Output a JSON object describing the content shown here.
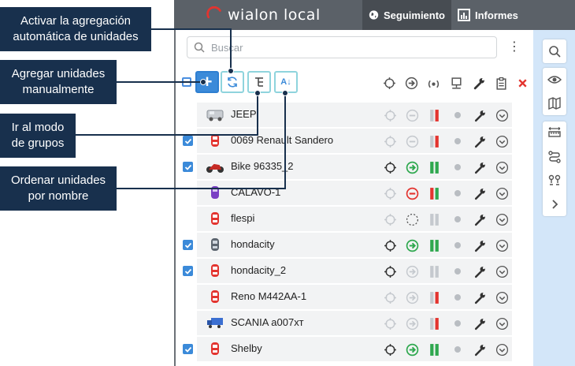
{
  "header": {
    "logo_text": "wialon local",
    "tabs": [
      {
        "label": "Seguimiento",
        "icon": "globe-icon",
        "active": true
      },
      {
        "label": "Informes",
        "icon": "chart-icon",
        "active": false
      }
    ],
    "colors": {
      "bar": "#5b6168",
      "active_tab": "#474c52",
      "logo_accent": "#e3342f"
    }
  },
  "search": {
    "placeholder": "Buscar",
    "value": ""
  },
  "toolbar": {
    "add_label": "+",
    "sort_label": "A↓",
    "right_icons": [
      "locator-icon",
      "arrow-right-circle-icon",
      "signal-icon",
      "monitor-icon",
      "wrench-icon",
      "clipboard-icon",
      "close-icon"
    ]
  },
  "callouts": [
    {
      "text": "Activar la agregación automática de unidades"
    },
    {
      "text": "Agregar unidades manualmente"
    },
    {
      "text": "Ir al modo de grupos"
    },
    {
      "text": "Ordenar unidades por nombre"
    }
  ],
  "units": [
    {
      "name": "JEEP",
      "checked": false,
      "icon": "jeep-icon",
      "loc": "grey",
      "move": "grey-minus",
      "sig": "grey-red",
      "active": false
    },
    {
      "name": "0069 Renault Sandero",
      "checked": true,
      "icon": "red-car-icon",
      "loc": "grey",
      "move": "grey-minus",
      "sig": "grey-red",
      "active": false
    },
    {
      "name": "Bike 96335_2",
      "checked": true,
      "icon": "motorbike-icon",
      "loc": "dark",
      "move": "green-arrow",
      "sig": "green",
      "active": true
    },
    {
      "name": "CALAVO-1",
      "checked": false,
      "icon": "purple-car-icon",
      "loc": "grey",
      "move": "red-minus",
      "sig": "red-green",
      "active": false
    },
    {
      "name": "flespi",
      "checked": false,
      "icon": "red-car-icon",
      "loc": "grey",
      "move": "dashed",
      "sig": "grey",
      "active": false
    },
    {
      "name": "hondacity",
      "checked": true,
      "icon": "grey-car-icon",
      "loc": "dark",
      "move": "green-arrow",
      "sig": "green",
      "active": true
    },
    {
      "name": "hondacity_2",
      "checked": true,
      "icon": "red-car-icon",
      "loc": "dark",
      "move": "grey-arrow",
      "sig": "grey",
      "active": true
    },
    {
      "name": "Reno M442AA-1",
      "checked": false,
      "icon": "red-car-icon",
      "loc": "grey",
      "move": "grey-arrow",
      "sig": "grey-red",
      "active": false
    },
    {
      "name": "SCANIA a007хт",
      "checked": false,
      "icon": "truck-icon",
      "loc": "grey",
      "move": "grey-arrow",
      "sig": "grey-red",
      "active": false
    },
    {
      "name": "Shelby",
      "checked": true,
      "icon": "red-car-icon",
      "loc": "dark",
      "move": "green-arrow",
      "sig": "green",
      "active": true
    }
  ],
  "sidebar": {
    "icons": [
      "search-icon",
      "eye-icon",
      "map-icon",
      "ruler-icon",
      "route-icon",
      "nodes-icon",
      "chevron-right-icon"
    ]
  }
}
